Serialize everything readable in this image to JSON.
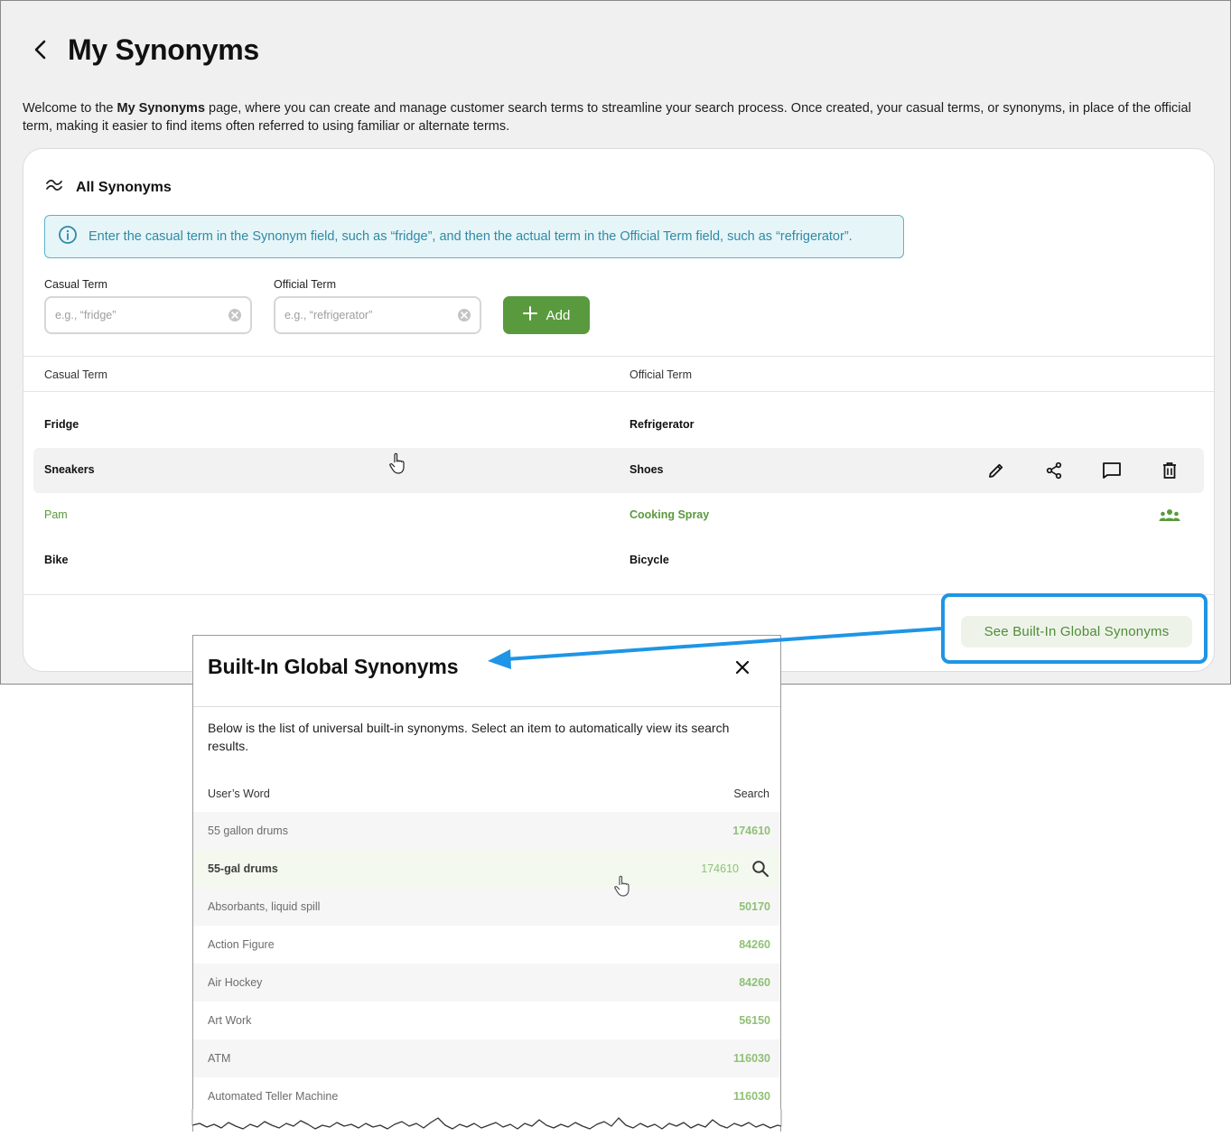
{
  "page": {
    "title": "My Synonyms",
    "intro_prefix": "Welcome to the ",
    "intro_bold": "My Synonyms",
    "intro_suffix": " page, where you can create and manage customer search terms to streamline your search process. Once created, your casual terms, or synonyms, in place of the official term, making it easier to find items often referred to using familiar or alternate terms."
  },
  "card": {
    "title": "All Synonyms",
    "info": "Enter the casual term in the Synonym field, such as “fridge”, and then the actual term in the Official Term field, such as “refrigerator”.",
    "casual_label": "Casual Term",
    "casual_placeholder": "e.g., “fridge”",
    "official_label": "Official Term",
    "official_placeholder": "e.g., “refrigerator”",
    "add_label": "Add",
    "col_casual": "Casual Term",
    "col_official": "Official Term",
    "rows": [
      {
        "casual": "Fridge",
        "official": "Refrigerator"
      },
      {
        "casual": "Sneakers",
        "official": "Shoes"
      },
      {
        "casual": "Pam",
        "official": "Cooking Spray"
      },
      {
        "casual": "Bike",
        "official": "Bicycle"
      }
    ],
    "global_button": "See Built-In Global Synonyms",
    "accent": "#5a9a3e",
    "highlight": "#1e95e6"
  },
  "modal": {
    "title": "Built-In Global Synonyms",
    "desc": "Below is the list of universal built-in synonyms. Select an item to automatically view its search results.",
    "col_word": "User’s Word",
    "col_search": "Search",
    "rows": [
      {
        "word": "55 gallon drums",
        "search": "174610"
      },
      {
        "word": "55-gal drums",
        "search": "174610"
      },
      {
        "word": "Absorbants, liquid spill",
        "search": "50170"
      },
      {
        "word": "Action Figure",
        "search": "84260"
      },
      {
        "word": "Air Hockey",
        "search": "84260"
      },
      {
        "word": "Art Work",
        "search": "56150"
      },
      {
        "word": "ATM",
        "search": "116030"
      },
      {
        "word": "Automated Teller Machine",
        "search": "116030"
      }
    ]
  }
}
